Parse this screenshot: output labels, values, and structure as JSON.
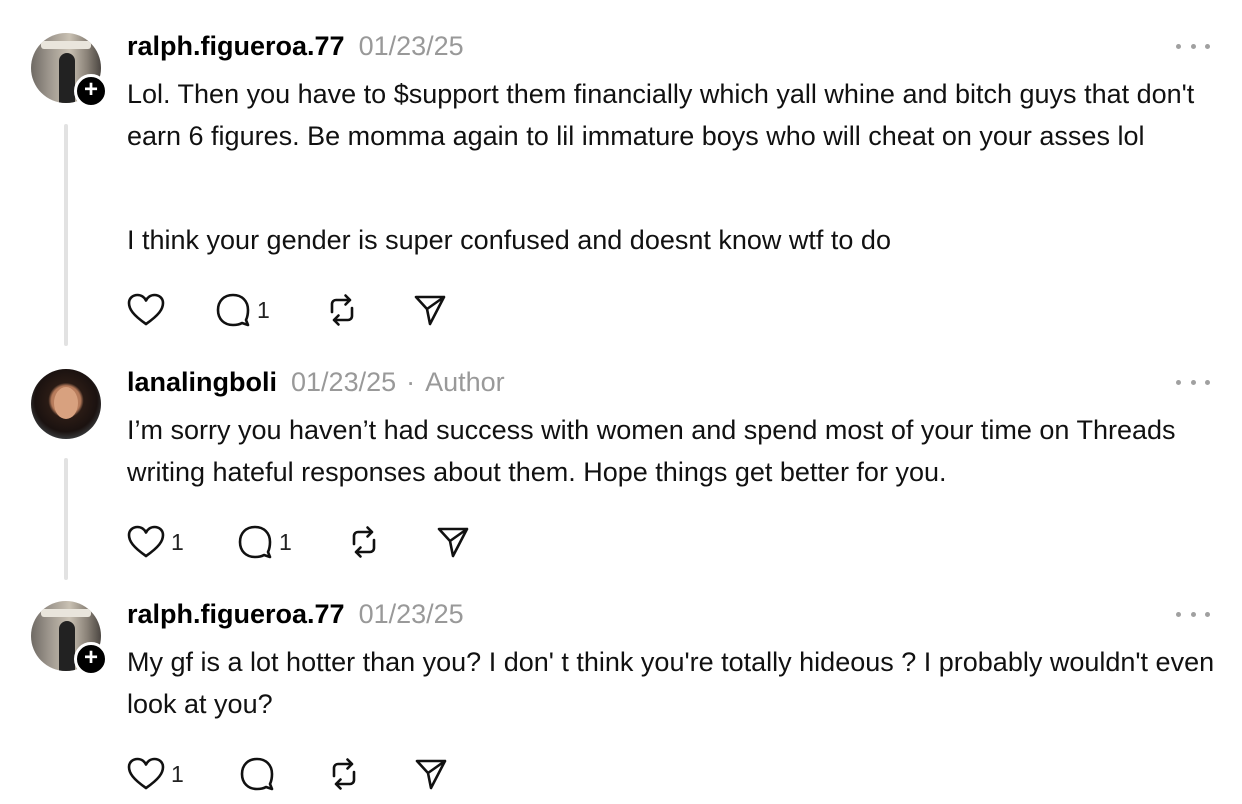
{
  "posts": [
    {
      "username": "ralph.figueroa.77",
      "date": "01/23/25",
      "paragraphs": [
        "Lol. Then you have to $support them financially which yall whine and bitch guys that don't earn 6 figures. Be momma again to lil immature boys who will cheat on your asses lol",
        "I think your gender is super confused and doesnt know wtf to do"
      ],
      "likes": "",
      "replies": "1",
      "avatar_icon": "profile-photo-man-in-hallway",
      "follow_icon": "+"
    },
    {
      "username": "lanalingboli",
      "date": "01/23/25",
      "separator": "·",
      "badge": "Author",
      "paragraphs": [
        "I’m sorry you haven’t had success with women and spend most of your time on Threads writing hateful responses about them. Hope things get better for you."
      ],
      "likes": "1",
      "replies": "1",
      "avatar_icon": "profile-photo-woman-selfie"
    },
    {
      "username": "ralph.figueroa.77",
      "date": "01/23/25",
      "paragraphs": [
        "My gf is a lot hotter than you? I don' t think you're totally hideous ? I probably wouldn't even look at you?"
      ],
      "likes": "1",
      "replies": "",
      "avatar_icon": "profile-photo-man-in-hallway",
      "follow_icon": "+"
    }
  ],
  "icons": {
    "like": "heart-icon",
    "reply": "comment-bubble-icon",
    "repost": "repost-icon",
    "share": "send-icon",
    "more": "more-dots-icon"
  },
  "colors": {
    "text": "#111111",
    "muted": "#999999",
    "thread_line": "#e2e2e2"
  }
}
